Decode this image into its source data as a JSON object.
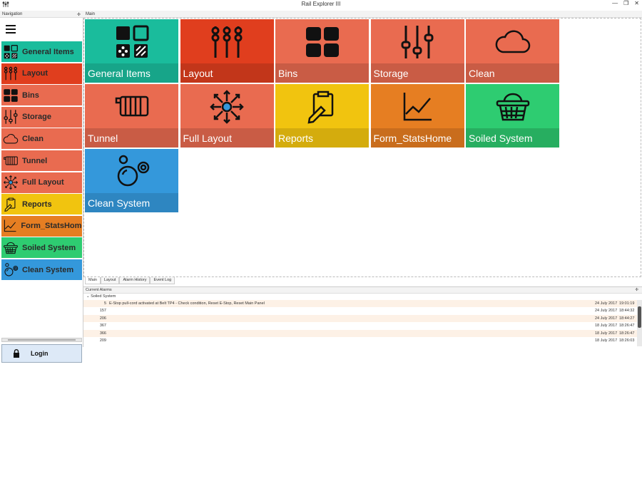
{
  "window": {
    "title": "Rail Explorer III"
  },
  "navigation": {
    "header": "Navigation",
    "items": [
      {
        "label": "General Items",
        "color": "#1abc9c",
        "icon": "general-items-icon"
      },
      {
        "label": "Layout",
        "color": "#e03e1e",
        "icon": "layout-icon"
      },
      {
        "label": "Bins",
        "color": "#e96b50",
        "icon": "bins-icon"
      },
      {
        "label": "Storage",
        "color": "#e96b50",
        "icon": "storage-icon"
      },
      {
        "label": "Clean",
        "color": "#e96b50",
        "icon": "cloud-icon"
      },
      {
        "label": "Tunnel",
        "color": "#e96b50",
        "icon": "tunnel-icon"
      },
      {
        "label": "Full Layout",
        "color": "#e96b50",
        "icon": "full-layout-icon"
      },
      {
        "label": "Reports",
        "color": "#f1c40f",
        "icon": "reports-icon"
      },
      {
        "label": "Form_StatsHome",
        "color": "#e67e22",
        "icon": "stats-chart-icon"
      },
      {
        "label": "Soiled System",
        "color": "#2ecc71",
        "icon": "basket-icon"
      },
      {
        "label": "Clean System",
        "color": "#3498db",
        "icon": "bubbles-icon"
      }
    ],
    "login_label": "Login"
  },
  "main": {
    "header": "Main",
    "tiles": [
      {
        "label": "General Items",
        "color": "#1abc9c",
        "band": "#17a589",
        "icon": "general-items-icon"
      },
      {
        "label": "Layout",
        "color": "#e03e1e",
        "band": "#c2361a",
        "icon": "layout-icon"
      },
      {
        "label": "Bins",
        "color": "#e96b50",
        "band": "#c95c45",
        "icon": "bins-icon"
      },
      {
        "label": "Storage",
        "color": "#e96b50",
        "band": "#c95c45",
        "icon": "storage-icon"
      },
      {
        "label": "Clean",
        "color": "#e96b50",
        "band": "#c95c45",
        "icon": "cloud-icon"
      },
      {
        "label": "Tunnel",
        "color": "#e96b50",
        "band": "#c95c45",
        "icon": "tunnel-icon"
      },
      {
        "label": "Full Layout",
        "color": "#e96b50",
        "band": "#c95c45",
        "icon": "full-layout-icon"
      },
      {
        "label": "Reports",
        "color": "#f1c40f",
        "band": "#d4ac0d",
        "icon": "reports-icon"
      },
      {
        "label": "Form_StatsHome",
        "color": "#e67e22",
        "band": "#c96d1d",
        "icon": "stats-chart-icon"
      },
      {
        "label": "Soiled System",
        "color": "#2ecc71",
        "band": "#27ae60",
        "icon": "basket-icon"
      },
      {
        "label": "Clean System",
        "color": "#3498db",
        "band": "#2e86c1",
        "icon": "bubbles-icon"
      }
    ]
  },
  "tabs": [
    "Main",
    "Layout",
    "Alarm History",
    "Event Log"
  ],
  "alarms": {
    "header": "Current Alarms",
    "group": "Soiled System",
    "rows": [
      {
        "id": "5",
        "message": "E-Stop pull-cord activated at Belt TP4 - Check condition, Reset E-Stop, Reset Main Panel",
        "date": "24 July 2017",
        "time": "19:01:19"
      },
      {
        "id": "157",
        "message": "",
        "date": "24 July 2017",
        "time": "18:44:32"
      },
      {
        "id": "206",
        "message": "",
        "date": "24 July 2017",
        "time": "18:44:27"
      },
      {
        "id": "367",
        "message": "",
        "date": "18 July 2017",
        "time": "18:26:47"
      },
      {
        "id": "366",
        "message": "",
        "date": "18 July 2017",
        "time": "18:26:47"
      },
      {
        "id": "209",
        "message": "",
        "date": "18 July 2017",
        "time": "18:26:03"
      }
    ]
  }
}
